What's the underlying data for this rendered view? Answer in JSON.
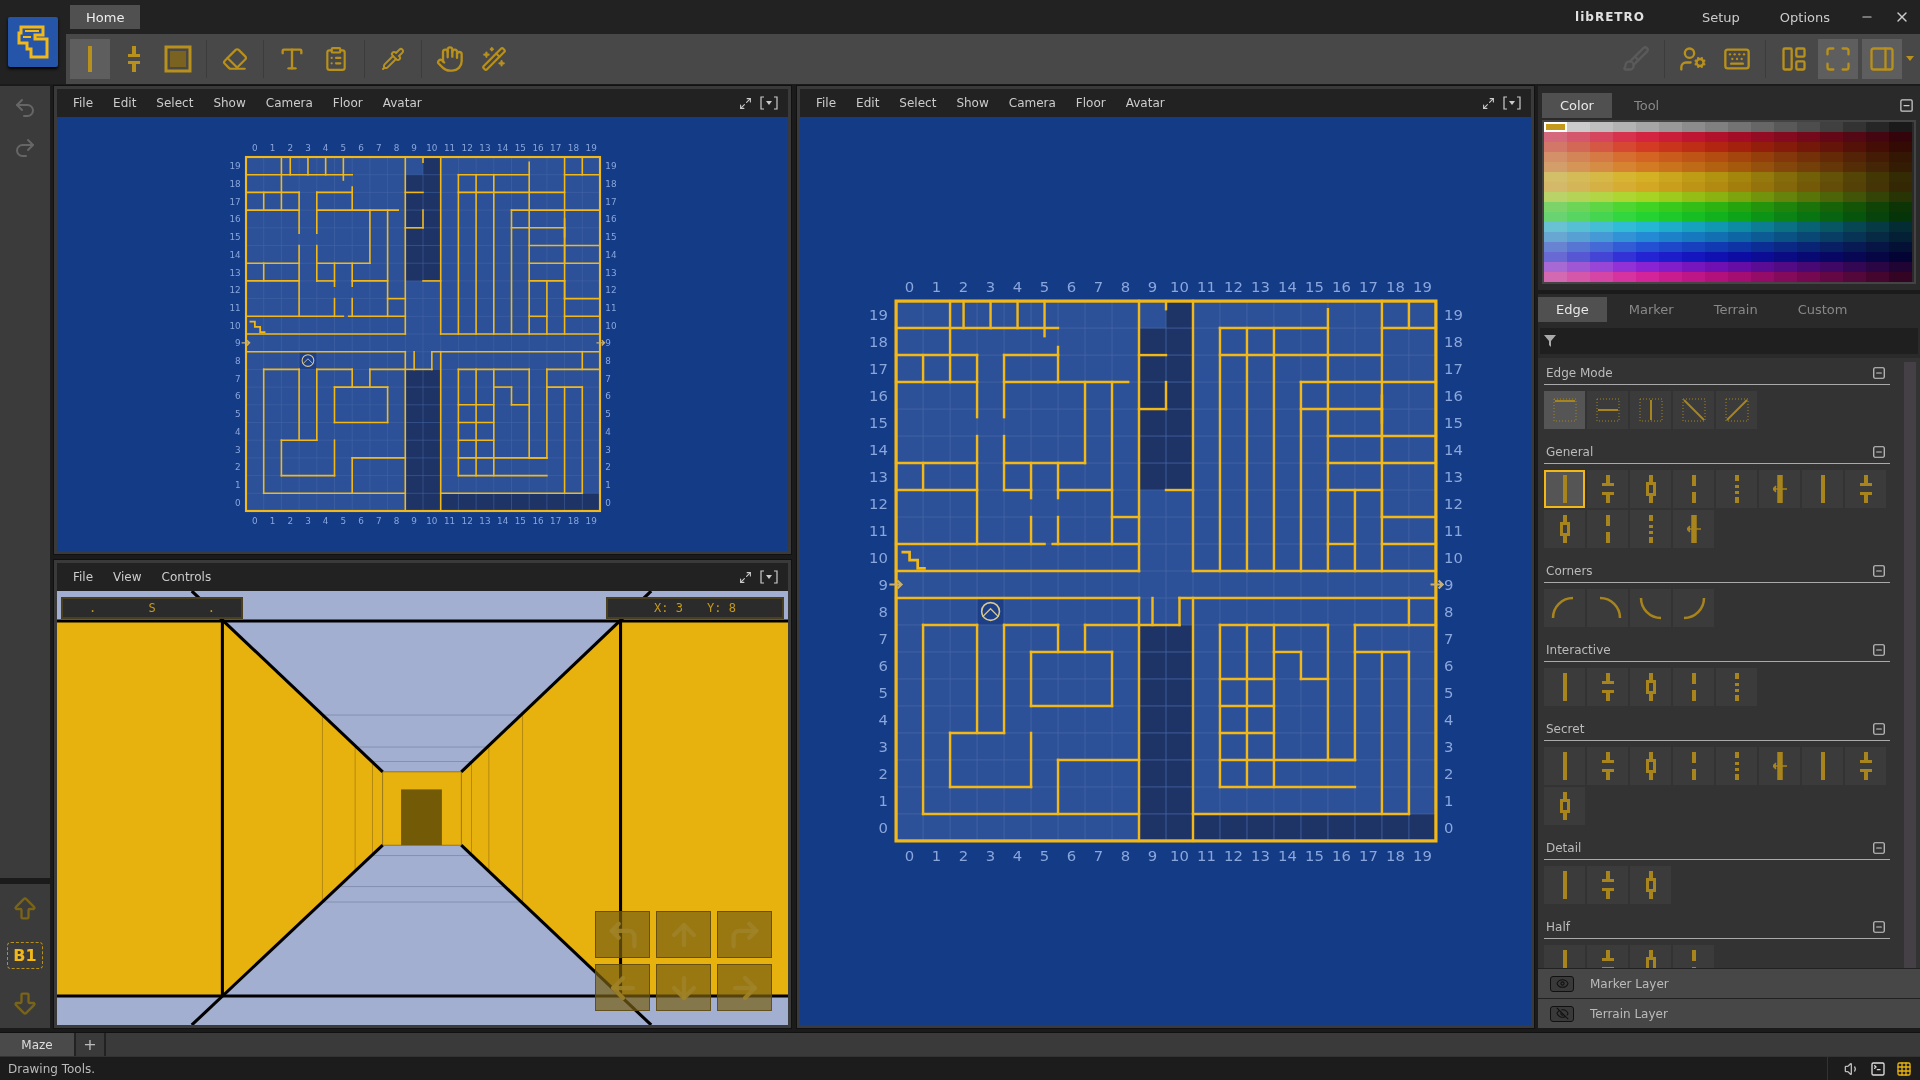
{
  "app": {
    "logo_label": "Home",
    "brand": "libRETRO",
    "menu": [
      "Setup",
      "Options"
    ]
  },
  "toolbar": {
    "tools": [
      {
        "selected": true
      },
      {
        "selected": false
      },
      {
        "selected": false
      },
      {
        "selected": false
      },
      {
        "selected": false
      },
      {
        "selected": false
      },
      {
        "selected": false
      },
      {
        "selected": false
      },
      {
        "selected": false
      }
    ],
    "right_tools": [
      {
        "selected": false,
        "disabled": true
      },
      {
        "selected": false,
        "disabled": false
      },
      {
        "selected": false,
        "disabled": false
      },
      {
        "selected": false,
        "disabled": false
      },
      {
        "selected": true,
        "disabled": false
      },
      {
        "selected": true,
        "disabled": false
      }
    ]
  },
  "floor": {
    "label": "B1"
  },
  "map_small": {
    "menu": [
      "File",
      "Edit",
      "Select",
      "Show",
      "Camera",
      "Floor",
      "Avatar"
    ],
    "top_labels": [
      "0",
      "1",
      "2",
      "3",
      "4",
      "5",
      "6",
      "7",
      "8",
      "9",
      "10",
      "11",
      "12",
      "13",
      "14",
      "15",
      "16",
      "17",
      "18",
      "19"
    ],
    "bottom_labels": [
      "0",
      "1",
      "2",
      "3",
      "4",
      "5",
      "6",
      "7",
      "8",
      "9",
      "10",
      "11",
      "12",
      "13",
      "14",
      "15",
      "16",
      "17",
      "18",
      "19"
    ],
    "left_labels": [
      "19",
      "18",
      "17",
      "16",
      "15",
      "14",
      "13",
      "12",
      "11",
      "10",
      "9",
      "8",
      "7",
      "6",
      "5",
      "4",
      "3",
      "2",
      "1",
      "0"
    ],
    "right_labels": [
      "19",
      "18",
      "17",
      "16",
      "15",
      "14",
      "13",
      "12",
      "11",
      "10",
      "9",
      "8",
      "7",
      "6",
      "5",
      "4",
      "3",
      "2",
      "1",
      "0"
    ]
  },
  "view": {
    "menu": [
      "File",
      "View",
      "Controls"
    ],
    "compass": [
      ".",
      "S",
      "."
    ],
    "position": [
      "X: 3",
      "Y: 8"
    ]
  },
  "map_large": {
    "menu": [
      "File",
      "Edit",
      "Select",
      "Show",
      "Camera",
      "Floor",
      "Avatar"
    ],
    "top_labels": [
      "0",
      "1",
      "2",
      "3",
      "4",
      "5",
      "6",
      "7",
      "8",
      "9",
      "10",
      "11",
      "12",
      "13",
      "14",
      "15",
      "16",
      "17",
      "18",
      "19"
    ],
    "bottom_labels": [
      "0",
      "1",
      "2",
      "3",
      "4",
      "5",
      "6",
      "7",
      "8",
      "9",
      "10",
      "11",
      "12",
      "13",
      "14",
      "15",
      "16",
      "17",
      "18",
      "19"
    ],
    "left_labels": [
      "19",
      "18",
      "17",
      "16",
      "15",
      "14",
      "13",
      "12",
      "11",
      "10",
      "9",
      "8",
      "7",
      "6",
      "5",
      "4",
      "3",
      "2",
      "1",
      "0"
    ],
    "right_labels": [
      "19",
      "18",
      "17",
      "16",
      "15",
      "14",
      "13",
      "12",
      "11",
      "10",
      "9",
      "8",
      "7",
      "6",
      "5",
      "4",
      "3",
      "2",
      "1",
      "0"
    ]
  },
  "color_panel": {
    "tabs": [
      {
        "label": "Color",
        "selected": true
      },
      {
        "label": "Tool",
        "selected": false
      }
    ]
  },
  "tool_panel": {
    "tabs": [
      {
        "label": "Edge",
        "selected": true
      },
      {
        "label": "Marker",
        "selected": false
      },
      {
        "label": "Terrain",
        "selected": false
      },
      {
        "label": "Custom",
        "selected": false
      }
    ],
    "sections": [
      {
        "title": "Edge Mode",
        "kind": "mode",
        "tools": [
          {
            "selected": true
          },
          {
            "selected": false
          },
          {
            "selected": false
          },
          {
            "selected": false
          },
          {
            "selected": false
          }
        ]
      },
      {
        "title": "General",
        "kind": "wall",
        "tools": [
          {
            "selected": true
          },
          {
            "selected": false
          },
          {
            "selected": false
          },
          {
            "selected": false
          },
          {
            "selected": false
          },
          {
            "selected": false
          },
          {
            "selected": false
          },
          {
            "selected": false
          },
          {
            "selected": false
          },
          {
            "selected": false
          },
          {
            "selected": false
          },
          {
            "selected": false
          }
        ]
      },
      {
        "title": "Corners",
        "kind": "corner",
        "tools": [
          {
            "selected": false
          },
          {
            "selected": false
          },
          {
            "selected": false
          },
          {
            "selected": false
          }
        ]
      },
      {
        "title": "Interactive",
        "kind": "wall",
        "tools": [
          {
            "selected": false
          },
          {
            "selected": false
          },
          {
            "selected": false
          },
          {
            "selected": false
          },
          {
            "selected": false
          }
        ]
      },
      {
        "title": "Secret",
        "kind": "wall",
        "tools": [
          {
            "selected": false
          },
          {
            "selected": false
          },
          {
            "selected": false
          },
          {
            "selected": false
          },
          {
            "selected": false
          },
          {
            "selected": false
          },
          {
            "selected": false
          },
          {
            "selected": false
          },
          {
            "selected": false
          }
        ]
      },
      {
        "title": "Detail",
        "kind": "wall",
        "tools": [
          {
            "selected": false
          },
          {
            "selected": false
          },
          {
            "selected": false
          }
        ]
      },
      {
        "title": "Half",
        "kind": "wall",
        "tools": [
          {
            "selected": false
          },
          {
            "selected": false
          },
          {
            "selected": false
          },
          {
            "selected": false
          }
        ]
      }
    ]
  },
  "layers": [
    {
      "name": "Marker Layer",
      "visible": true
    },
    {
      "name": "Terrain Layer",
      "visible": false
    }
  ],
  "document_tabs": [
    {
      "label": "Maze",
      "selected": true
    }
  ],
  "add_tab": "+",
  "status_bar": {
    "text": "Drawing Tools."
  }
}
